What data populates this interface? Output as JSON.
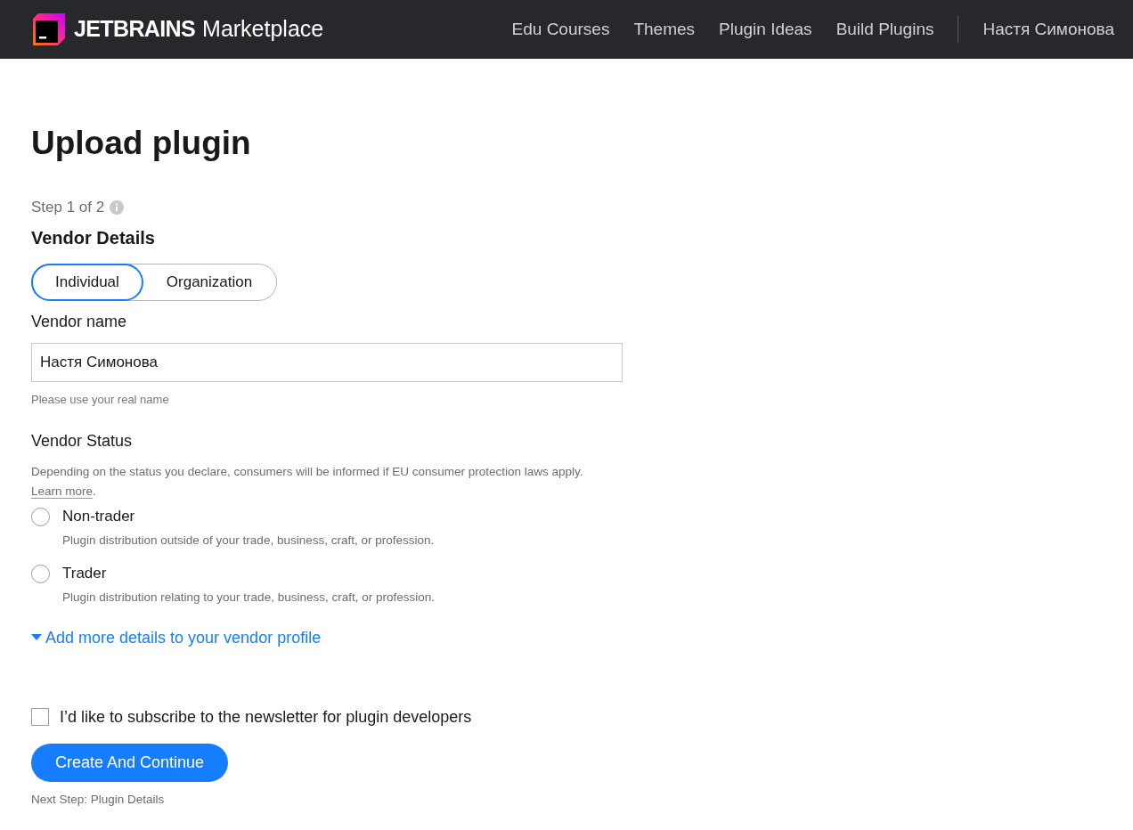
{
  "header": {
    "logo_bold": "JETBRAINS",
    "logo_text": "Marketplace",
    "nav": [
      "Edu Courses",
      "Themes",
      "Plugin Ideas",
      "Build Plugins"
    ],
    "user": "Настя Симонова"
  },
  "title": "Upload plugin",
  "step": "Step 1 of 2",
  "section_title": "Vendor Details",
  "vendor_type": [
    {
      "label": "Individual",
      "selected": true
    },
    {
      "label": "Organization",
      "selected": false
    }
  ],
  "vendor_name": {
    "label": "Vendor name",
    "value": "Настя Симонова",
    "hint": "Please use your real name"
  },
  "vendor_status": {
    "label": "Vendor Status",
    "description_before": "Depending on the status you declare, consumers will be informed if EU consumer protection laws apply. ",
    "link": "Learn more",
    "description_after": ".",
    "options": [
      {
        "label": "Non-trader",
        "description": "Plugin distribution outside of your trade, business, craft, or profession.",
        "selected": false
      },
      {
        "label": "Trader",
        "description": "Plugin distribution relating to your trade, business, craft, or profession.",
        "selected": false
      }
    ]
  },
  "more_details": {
    "label": "Add more details to your vendor profile",
    "expanded": false
  },
  "newsletter": {
    "label": "I’d like to subscribe to the newsletter for plugin developers",
    "checked": false
  },
  "submit": "Create And Continue",
  "next_step": "Next Step: Plugin Details"
}
